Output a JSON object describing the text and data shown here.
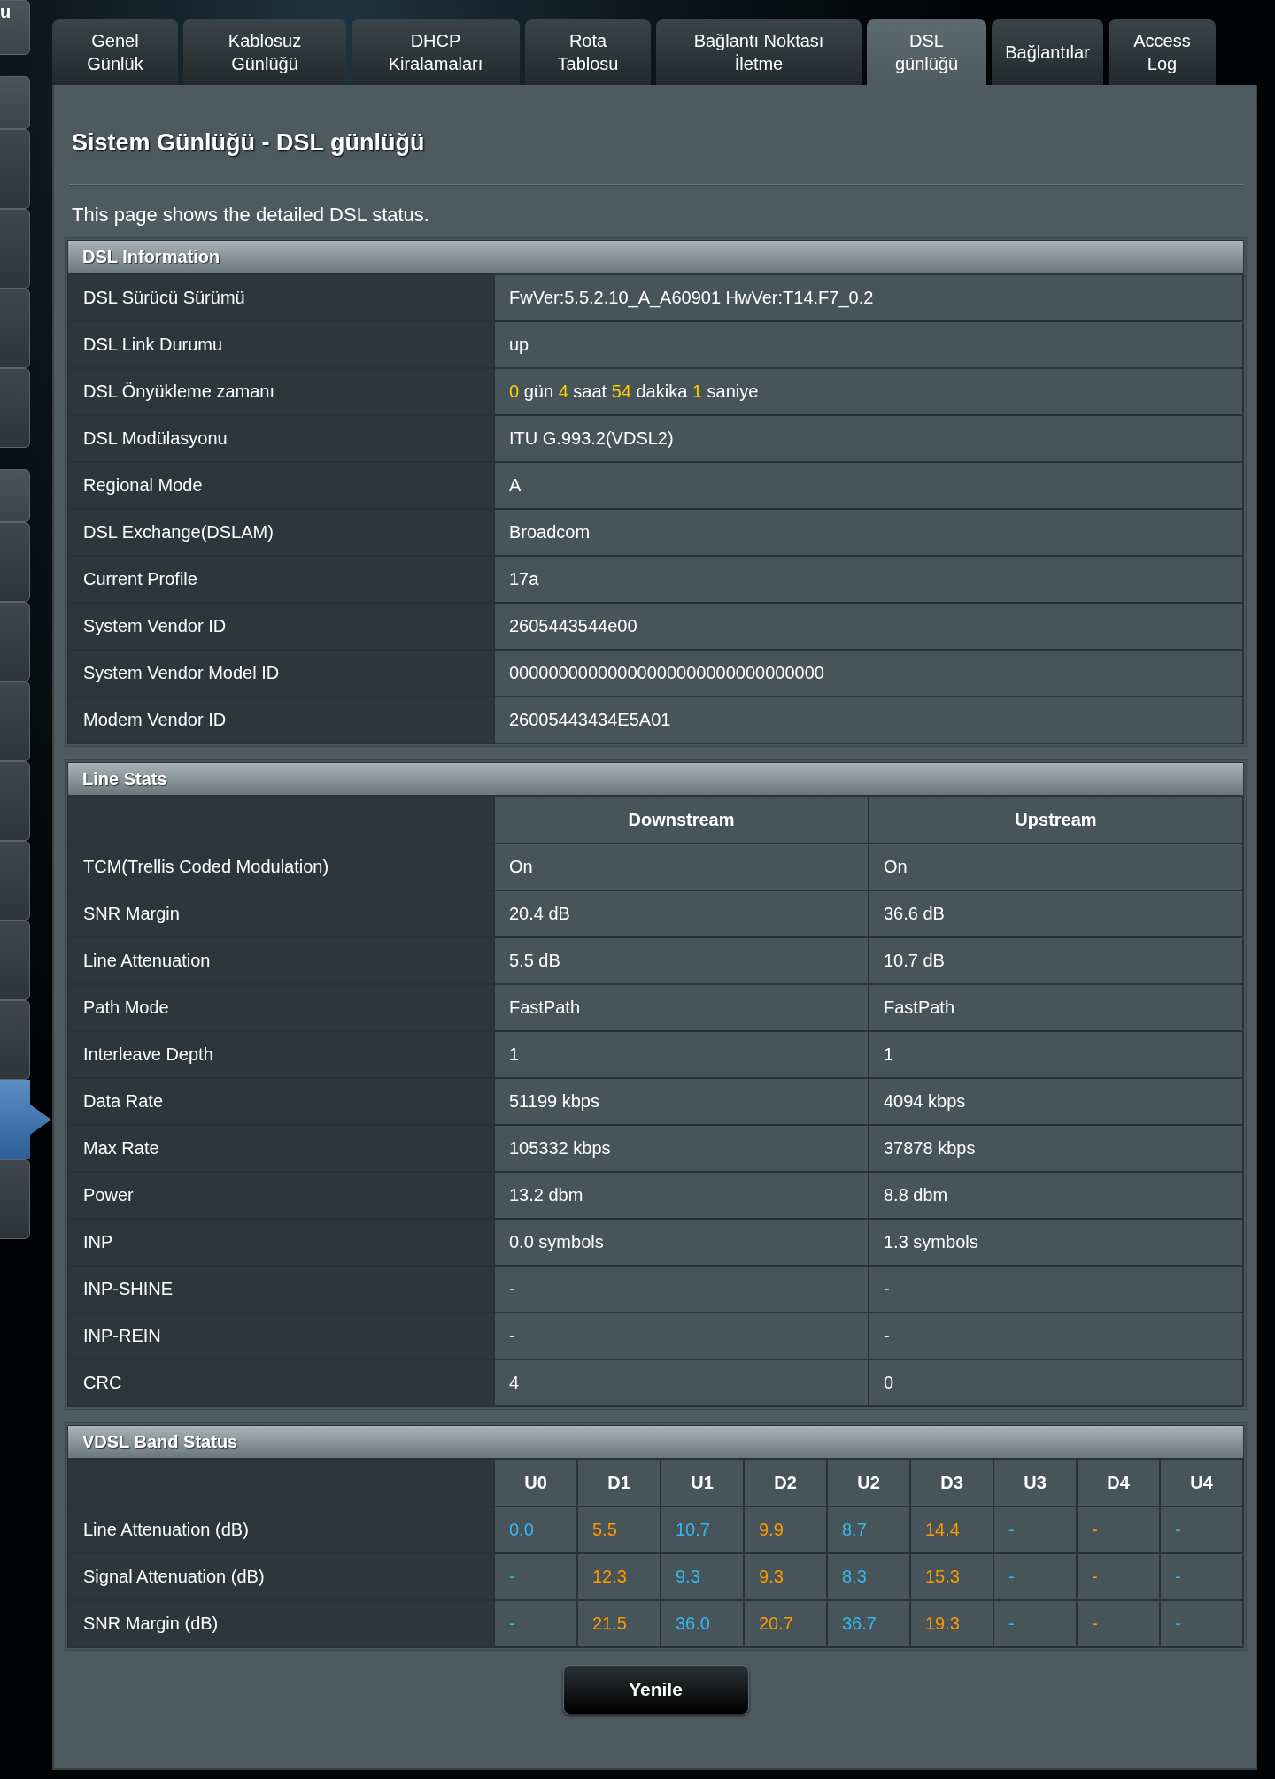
{
  "sidebar": {
    "groups": [
      {
        "items": [
          {
            "kind": "header",
            "label": "u",
            "selected": false
          }
        ]
      },
      {
        "items": [
          {
            "kind": "header",
            "selected": false
          },
          {
            "kind": "item",
            "selected": false
          },
          {
            "kind": "item",
            "selected": false
          },
          {
            "kind": "item",
            "selected": false
          },
          {
            "kind": "item",
            "selected": false
          }
        ]
      },
      {
        "items": [
          {
            "kind": "header",
            "selected": false
          },
          {
            "kind": "item",
            "selected": false
          },
          {
            "kind": "item",
            "selected": false
          },
          {
            "kind": "item",
            "selected": false
          },
          {
            "kind": "item",
            "selected": false
          },
          {
            "kind": "item",
            "selected": false
          },
          {
            "kind": "item",
            "selected": false
          },
          {
            "kind": "item",
            "selected": false
          },
          {
            "kind": "item",
            "selected": true
          },
          {
            "kind": "item",
            "selected": false
          }
        ]
      }
    ]
  },
  "tabs": [
    {
      "label": "Genel\nGünlük",
      "selected": false
    },
    {
      "label": "Kablosuz\nGünlüğü",
      "selected": false
    },
    {
      "label": "DHCP\nKiralamaları",
      "selected": false
    },
    {
      "label": "Rota\nTablosu",
      "selected": false
    },
    {
      "label": "Bağlantı Noktası\nİletme",
      "selected": false
    },
    {
      "label": "DSL\ngünlüğü",
      "selected": true
    },
    {
      "label": "Bağlantılar",
      "selected": false
    },
    {
      "label": "Access\nLog",
      "selected": false
    }
  ],
  "page": {
    "title": "Sistem Günlüğü - DSL günlüğü",
    "description": "This page shows the detailed DSL status."
  },
  "dsl_information": {
    "title": "DSL Information",
    "rows": [
      {
        "label": "DSL Sürücü Sürümü",
        "value": "FwVer:5.5.2.10_A_A60901 HwVer:T14.F7_0.2"
      },
      {
        "label": "DSL Link Durumu",
        "value": "up"
      },
      {
        "label": "DSL Önyükleme zamanı",
        "parts": [
          {
            "kind": "number",
            "text": "0"
          },
          {
            "kind": "word",
            "text": "gün"
          },
          {
            "kind": "number",
            "text": "4"
          },
          {
            "kind": "word",
            "text": "saat"
          },
          {
            "kind": "number",
            "text": "54"
          },
          {
            "kind": "word",
            "text": "dakika"
          },
          {
            "kind": "number",
            "text": "1"
          },
          {
            "kind": "word",
            "text": "saniye"
          }
        ]
      },
      {
        "label": "DSL Modülasyonu",
        "value": "ITU G.993.2(VDSL2)"
      },
      {
        "label": "Regional Mode",
        "value": "A"
      },
      {
        "label": "DSL Exchange(DSLAM)",
        "value": "Broadcom"
      },
      {
        "label": "Current Profile",
        "value": "17a"
      },
      {
        "label": "System Vendor ID",
        "value": "2605443544e00"
      },
      {
        "label": "System Vendor Model ID",
        "value": "00000000000000000000000000000000"
      },
      {
        "label": "Modem Vendor ID",
        "value": "26005443434E5A01"
      }
    ]
  },
  "line_stats": {
    "title": "Line Stats",
    "columns": [
      "Downstream",
      "Upstream"
    ],
    "rows": [
      {
        "label": "TCM(Trellis Coded Modulation)",
        "values": [
          "On",
          "On"
        ]
      },
      {
        "label": "SNR Margin",
        "values": [
          "20.4 dB",
          "36.6 dB"
        ]
      },
      {
        "label": "Line Attenuation",
        "values": [
          "5.5 dB",
          "10.7 dB"
        ]
      },
      {
        "label": "Path Mode",
        "values": [
          "FastPath",
          "FastPath"
        ]
      },
      {
        "label": "Interleave Depth",
        "values": [
          "1",
          "1"
        ]
      },
      {
        "label": "Data Rate",
        "values": [
          "51199 kbps",
          "4094 kbps"
        ]
      },
      {
        "label": "Max Rate",
        "values": [
          "105332 kbps",
          "37878 kbps"
        ]
      },
      {
        "label": "Power",
        "values": [
          "13.2 dbm",
          "8.8 dbm"
        ]
      },
      {
        "label": "INP",
        "values": [
          "0.0 symbols",
          "1.3 symbols"
        ]
      },
      {
        "label": "INP-SHINE",
        "values": [
          "-",
          "-"
        ]
      },
      {
        "label": "INP-REIN",
        "values": [
          "-",
          "-"
        ]
      },
      {
        "label": "CRC",
        "values": [
          "4",
          "0"
        ]
      }
    ]
  },
  "vdsl_band_status": {
    "title": "VDSL Band Status",
    "columns": [
      {
        "label": "U0",
        "color": "#33bbee"
      },
      {
        "label": "D1",
        "color": "#ff9900"
      },
      {
        "label": "U1",
        "color": "#33bbee"
      },
      {
        "label": "D2",
        "color": "#ff9900"
      },
      {
        "label": "U2",
        "color": "#33bbee"
      },
      {
        "label": "D3",
        "color": "#ff9900"
      },
      {
        "label": "U3",
        "color": "#33bbee"
      },
      {
        "label": "D4",
        "color": "#ff9900"
      },
      {
        "label": "U4",
        "color": "#33bbee"
      }
    ],
    "rows": [
      {
        "label": "Line Attenuation (dB)",
        "values": [
          "0.0",
          "5.5",
          "10.7",
          "9.9",
          "8.7",
          "14.4",
          "-",
          "-",
          "-"
        ]
      },
      {
        "label": "Signal Attenuation (dB)",
        "values": [
          "-",
          "12.3",
          "9.3",
          "9.3",
          "8.3",
          "15.3",
          "-",
          "-",
          "-"
        ]
      },
      {
        "label": "SNR Margin (dB)",
        "values": [
          "-",
          "21.5",
          "36.0",
          "20.7",
          "36.7",
          "19.3",
          "-",
          "-",
          "-"
        ]
      }
    ]
  },
  "refresh_button": {
    "label": "Yenile"
  }
}
